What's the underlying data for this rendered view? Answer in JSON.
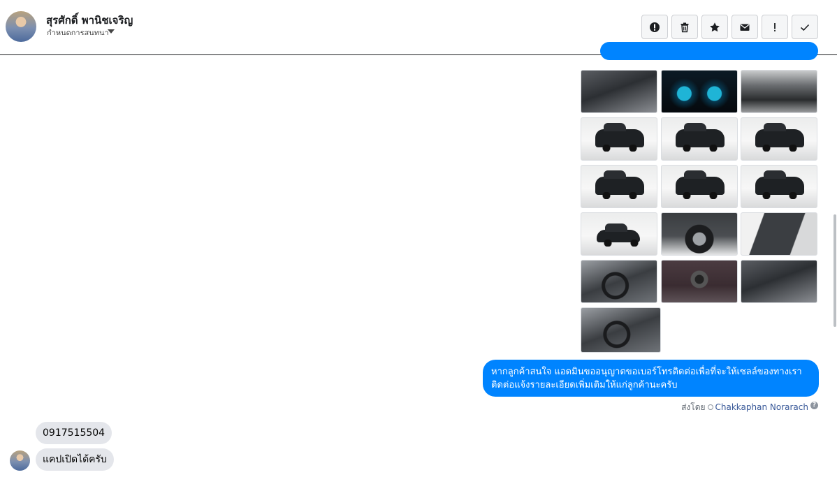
{
  "header": {
    "contact_name": "สุรศักดิ์ พานิชเจริญ",
    "conversation_label": "กำหนดการสนทนา",
    "toolbar": [
      {
        "name": "report-spam-button",
        "icon": "alert-circle-icon"
      },
      {
        "name": "delete-button",
        "icon": "trash-icon"
      },
      {
        "name": "star-button",
        "icon": "star-icon"
      },
      {
        "name": "mark-unread-button",
        "icon": "envelope-icon"
      },
      {
        "name": "mark-important-button",
        "icon": "exclamation-icon"
      },
      {
        "name": "mark-done-button",
        "icon": "check-icon"
      }
    ]
  },
  "photos": [
    {
      "kind": "interior"
    },
    {
      "kind": "gauge"
    },
    {
      "kind": "engine"
    },
    {
      "kind": "studio-front"
    },
    {
      "kind": "studio-front"
    },
    {
      "kind": "studio-front"
    },
    {
      "kind": "studio-rear"
    },
    {
      "kind": "studio-rear"
    },
    {
      "kind": "studio-rear"
    },
    {
      "kind": "studio-side"
    },
    {
      "kind": "wheel"
    },
    {
      "kind": "door"
    },
    {
      "kind": "steering"
    },
    {
      "kind": "shifter"
    },
    {
      "kind": "seat"
    },
    {
      "kind": "steering"
    }
  ],
  "messages": {
    "sent_text": "หากลูกค้าสนใจ แอดมินขออนุญาตขอเบอร์โทรติดต่อเพื่อที่จะให้เซลล์ของทางเราติดต่อแจ้งรายละเอียดเพิ่มเติมให้แก่ลูกค้านะครับ",
    "sent_by_prefix": "ส่งโดย",
    "sent_by_name": "Chakkaphan Norarach",
    "received": [
      "0917515504",
      "แคปเปิดได้ครับ"
    ]
  },
  "colors": {
    "sent_bubble": "#0084ff",
    "received_bubble": "#e4e6eb",
    "sender_link": "#385898"
  }
}
